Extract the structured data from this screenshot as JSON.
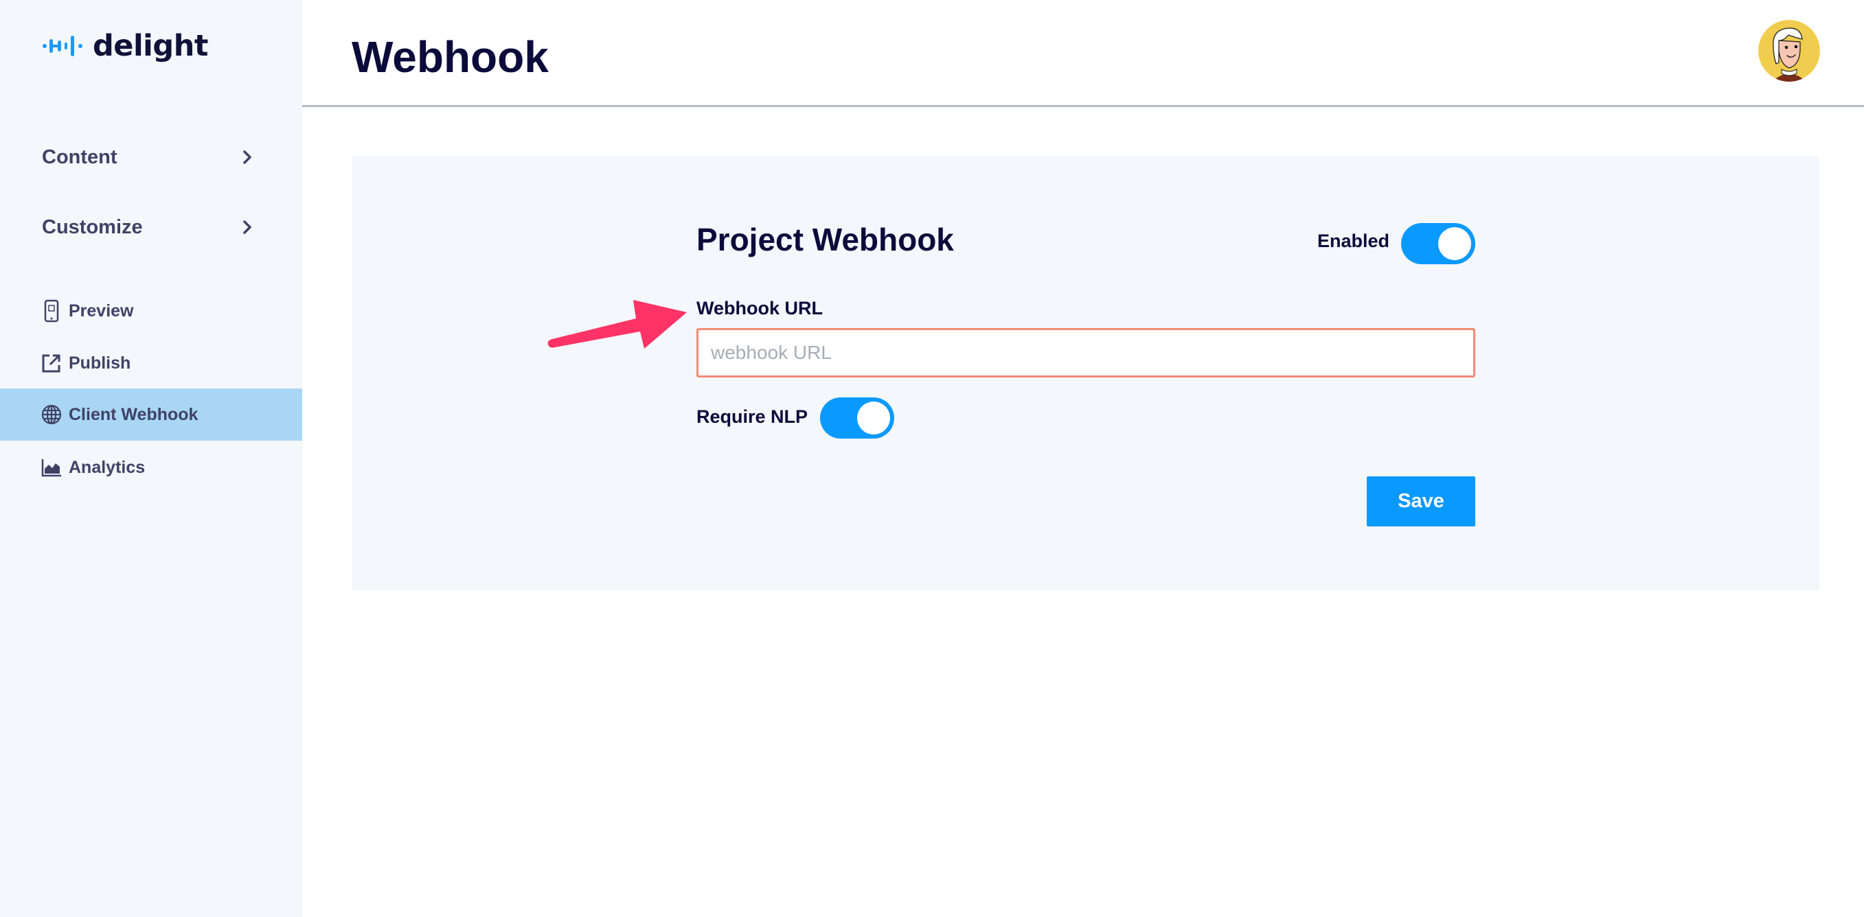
{
  "app": {
    "brand_name": "delight",
    "brand_color": "#1a9bff"
  },
  "sidebar": {
    "groups": [
      {
        "label": "Content",
        "icon": "chevron-right-icon"
      },
      {
        "label": "Customize",
        "icon": "chevron-right-icon"
      }
    ],
    "items": [
      {
        "label": "Preview",
        "icon": "phone-qr-icon",
        "active": false
      },
      {
        "label": "Publish",
        "icon": "external-link-icon",
        "active": false
      },
      {
        "label": "Client Webhook",
        "icon": "globe-icon",
        "active": true
      },
      {
        "label": "Analytics",
        "icon": "area-chart-icon",
        "active": false
      }
    ],
    "active_bg": "#a9d6f5"
  },
  "header": {
    "title": "Webhook",
    "avatar": "user-avatar"
  },
  "form": {
    "title": "Project Webhook",
    "enabled_label": "Enabled",
    "enabled": true,
    "url_label": "Webhook URL",
    "url_value": "",
    "url_placeholder": "webhook URL",
    "nlp_label": "Require NLP",
    "require_nlp": true,
    "save_label": "Save",
    "accent_color": "#0a99ff",
    "input_border_color": "#f28a76"
  },
  "annotation": {
    "arrow_color": "#ff3366",
    "points_to": "Webhook URL"
  }
}
